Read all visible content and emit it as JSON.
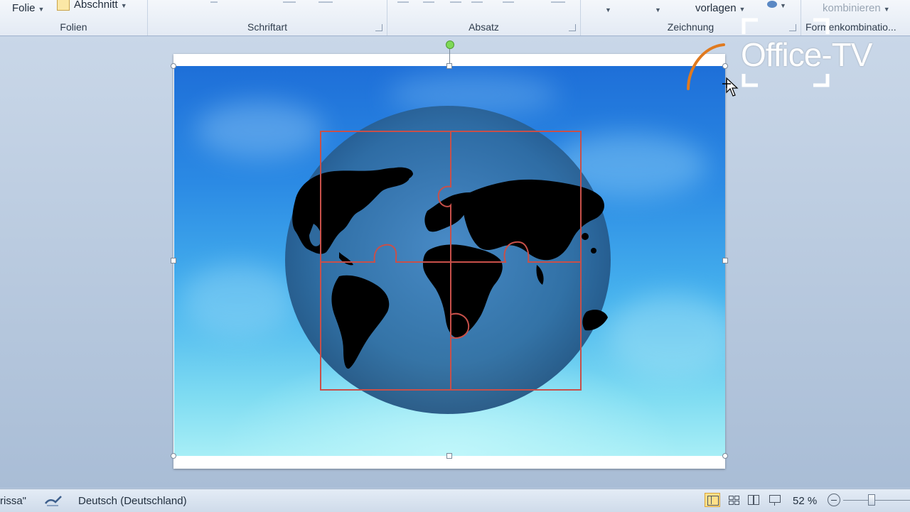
{
  "ribbon": {
    "folie_label": "Folie",
    "abschnitt_label": "Abschnitt",
    "schnellformatvorlagen_label": "vorlagen",
    "kombinieren_label": "kombinieren",
    "groups": {
      "folien": "Folien",
      "schriftart": "Schriftart",
      "absatz": "Absatz",
      "zeichnung": "Zeichnung",
      "formenkombination": "Formenkombinatio..."
    }
  },
  "logo": {
    "text": "Office-TV",
    "arc_color": "#e07a1f"
  },
  "status": {
    "theme_text": "rissa\"",
    "language": "Deutsch (Deutschland)",
    "zoom": "52 %"
  },
  "colors": {
    "puzzle_stroke": "#c8504a",
    "sky_top": "#1e6fd8",
    "sky_bottom": "#a7eef6"
  }
}
